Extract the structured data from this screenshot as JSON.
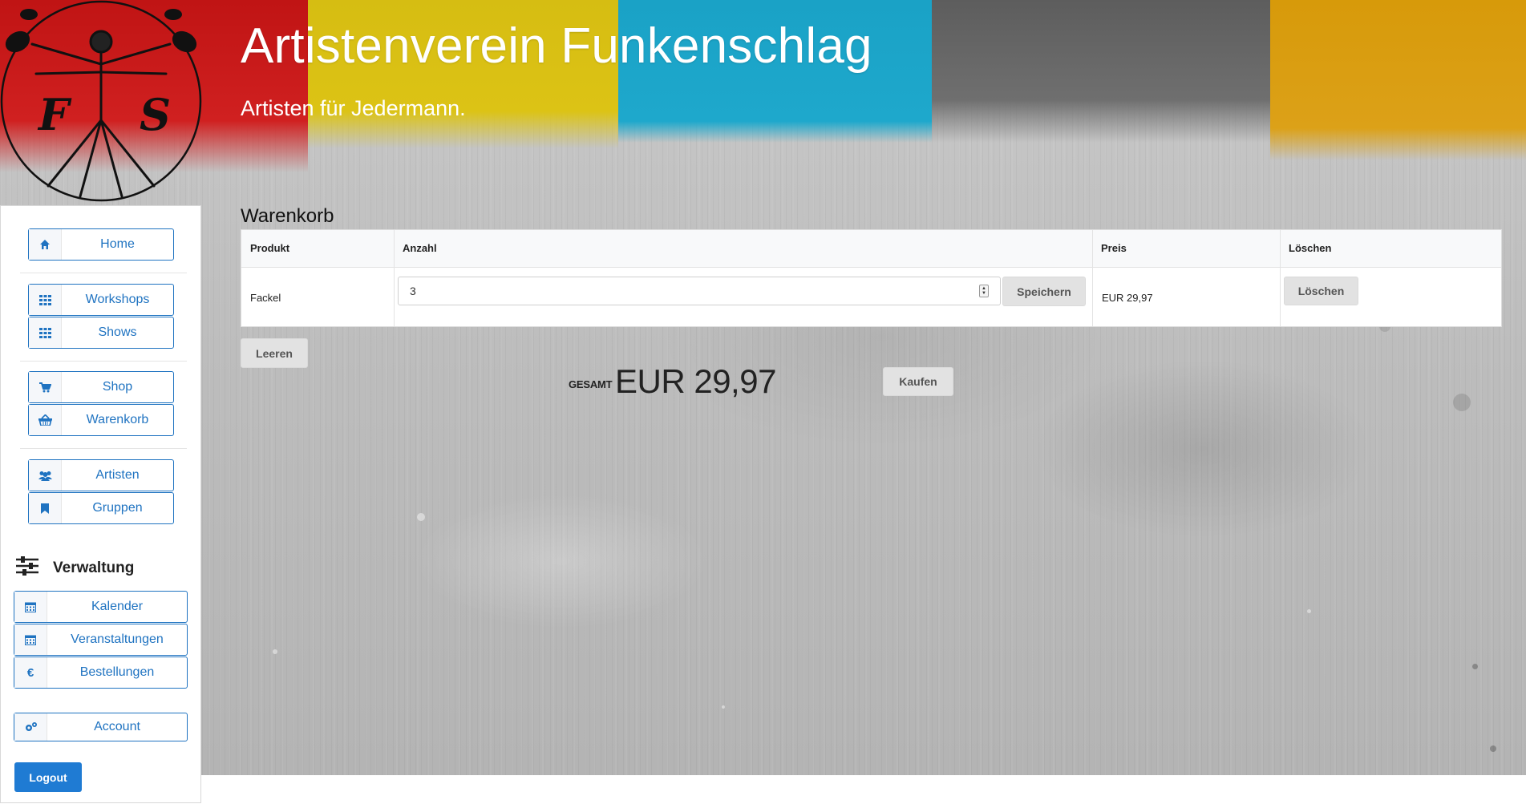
{
  "header": {
    "title": "Artistenverein Funkenschlag",
    "tagline": "Artisten für Jedermann.",
    "logo_letters": [
      "F",
      "S"
    ]
  },
  "sidebar": {
    "groups": [
      [
        {
          "label": "Home",
          "icon": "home-icon"
        }
      ],
      [
        {
          "label": "Workshops",
          "icon": "grid-icon"
        },
        {
          "label": "Shows",
          "icon": "grid-icon"
        }
      ],
      [
        {
          "label": "Shop",
          "icon": "cart-icon"
        },
        {
          "label": "Warenkorb",
          "icon": "basket-icon"
        }
      ],
      [
        {
          "label": "Artisten",
          "icon": "users-icon"
        },
        {
          "label": "Gruppen",
          "icon": "bookmark-icon"
        }
      ]
    ],
    "admin_title": "Verwaltung",
    "admin_items": [
      {
        "label": "Kalender",
        "icon": "calendar-icon"
      },
      {
        "label": "Veranstaltungen",
        "icon": "calendar-icon"
      },
      {
        "label": "Bestellungen",
        "icon": "euro-icon"
      }
    ],
    "account_label": "Account",
    "logout_label": "Logout"
  },
  "cart": {
    "title": "Warenkorb",
    "columns": [
      "Produkt",
      "Anzahl",
      "Preis",
      "Löschen"
    ],
    "rows": [
      {
        "product": "Fackel",
        "quantity": "3",
        "save_label": "Speichern",
        "price": "EUR 29,97",
        "delete_label": "Löschen"
      }
    ],
    "clear_label": "Leeren",
    "total_label": "GESAMT",
    "total_value": "EUR 29,97",
    "buy_label": "Kaufen"
  },
  "colors": {
    "accent": "#1f73c1",
    "logout_bg": "#1f7bd3",
    "strip_red": "#c01414",
    "strip_yellow": "#d6bd12",
    "strip_cyan": "#1aa2c6",
    "strip_gray": "#5d5d5d",
    "strip_orange": "#d79a0a"
  }
}
